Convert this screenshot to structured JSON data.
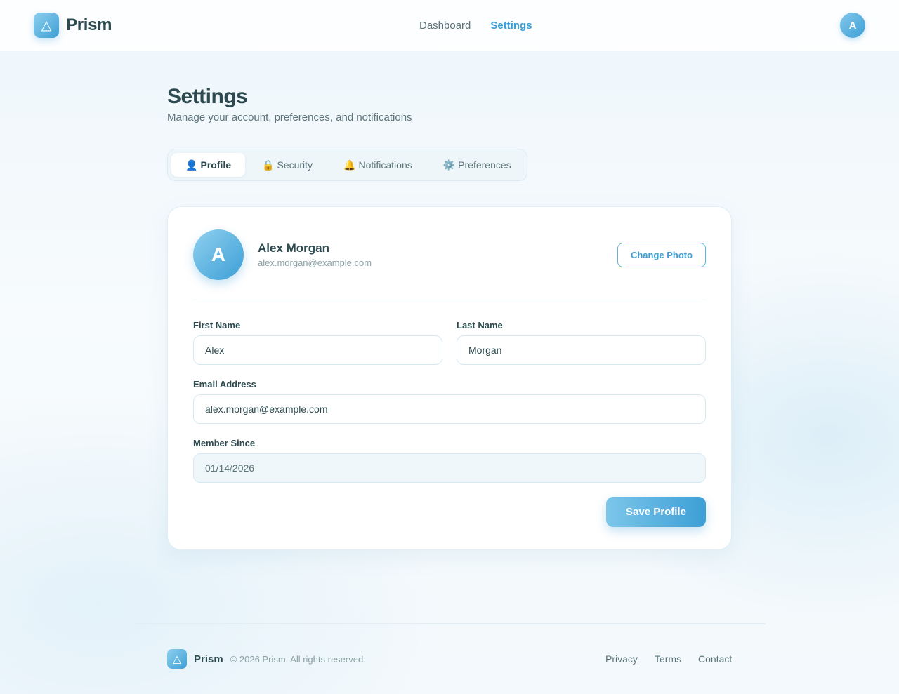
{
  "header": {
    "brand_icon": "△",
    "brand_name": "Prism",
    "nav": [
      {
        "label": "Dashboard",
        "active": false
      },
      {
        "label": "Settings",
        "active": true
      }
    ],
    "avatar_initial": "A"
  },
  "page": {
    "title": "Settings",
    "subtitle": "Manage your account, preferences, and notifications"
  },
  "tabs": [
    {
      "icon": "👤",
      "icon_name": "user-icon",
      "label": "Profile",
      "active": true
    },
    {
      "icon": "🔒",
      "icon_name": "lock-icon",
      "label": "Security",
      "active": false
    },
    {
      "icon": "🔔",
      "icon_name": "bell-icon",
      "label": "Notifications",
      "active": false
    },
    {
      "icon": "⚙️",
      "icon_name": "gear-icon",
      "label": "Preferences",
      "active": false
    }
  ],
  "profile": {
    "avatar_initial": "A",
    "name": "Alex Morgan",
    "email": "alex.morgan@example.com",
    "change_photo_label": "Change Photo"
  },
  "form": {
    "first_name": {
      "label": "First Name",
      "value": "Alex"
    },
    "last_name": {
      "label": "Last Name",
      "value": "Morgan"
    },
    "email": {
      "label": "Email Address",
      "value": "alex.morgan@example.com"
    },
    "member_since": {
      "label": "Member Since",
      "value": "01/14/2026"
    },
    "save_label": "Save Profile"
  },
  "footer": {
    "brand_icon": "△",
    "brand_name": "Prism",
    "copyright": "© 2026 Prism. All rights reserved.",
    "links": [
      "Privacy",
      "Terms",
      "Contact"
    ]
  },
  "colors": {
    "accent": "#3d9fd6",
    "text": "#2c4a4f",
    "muted": "#5b7479"
  }
}
